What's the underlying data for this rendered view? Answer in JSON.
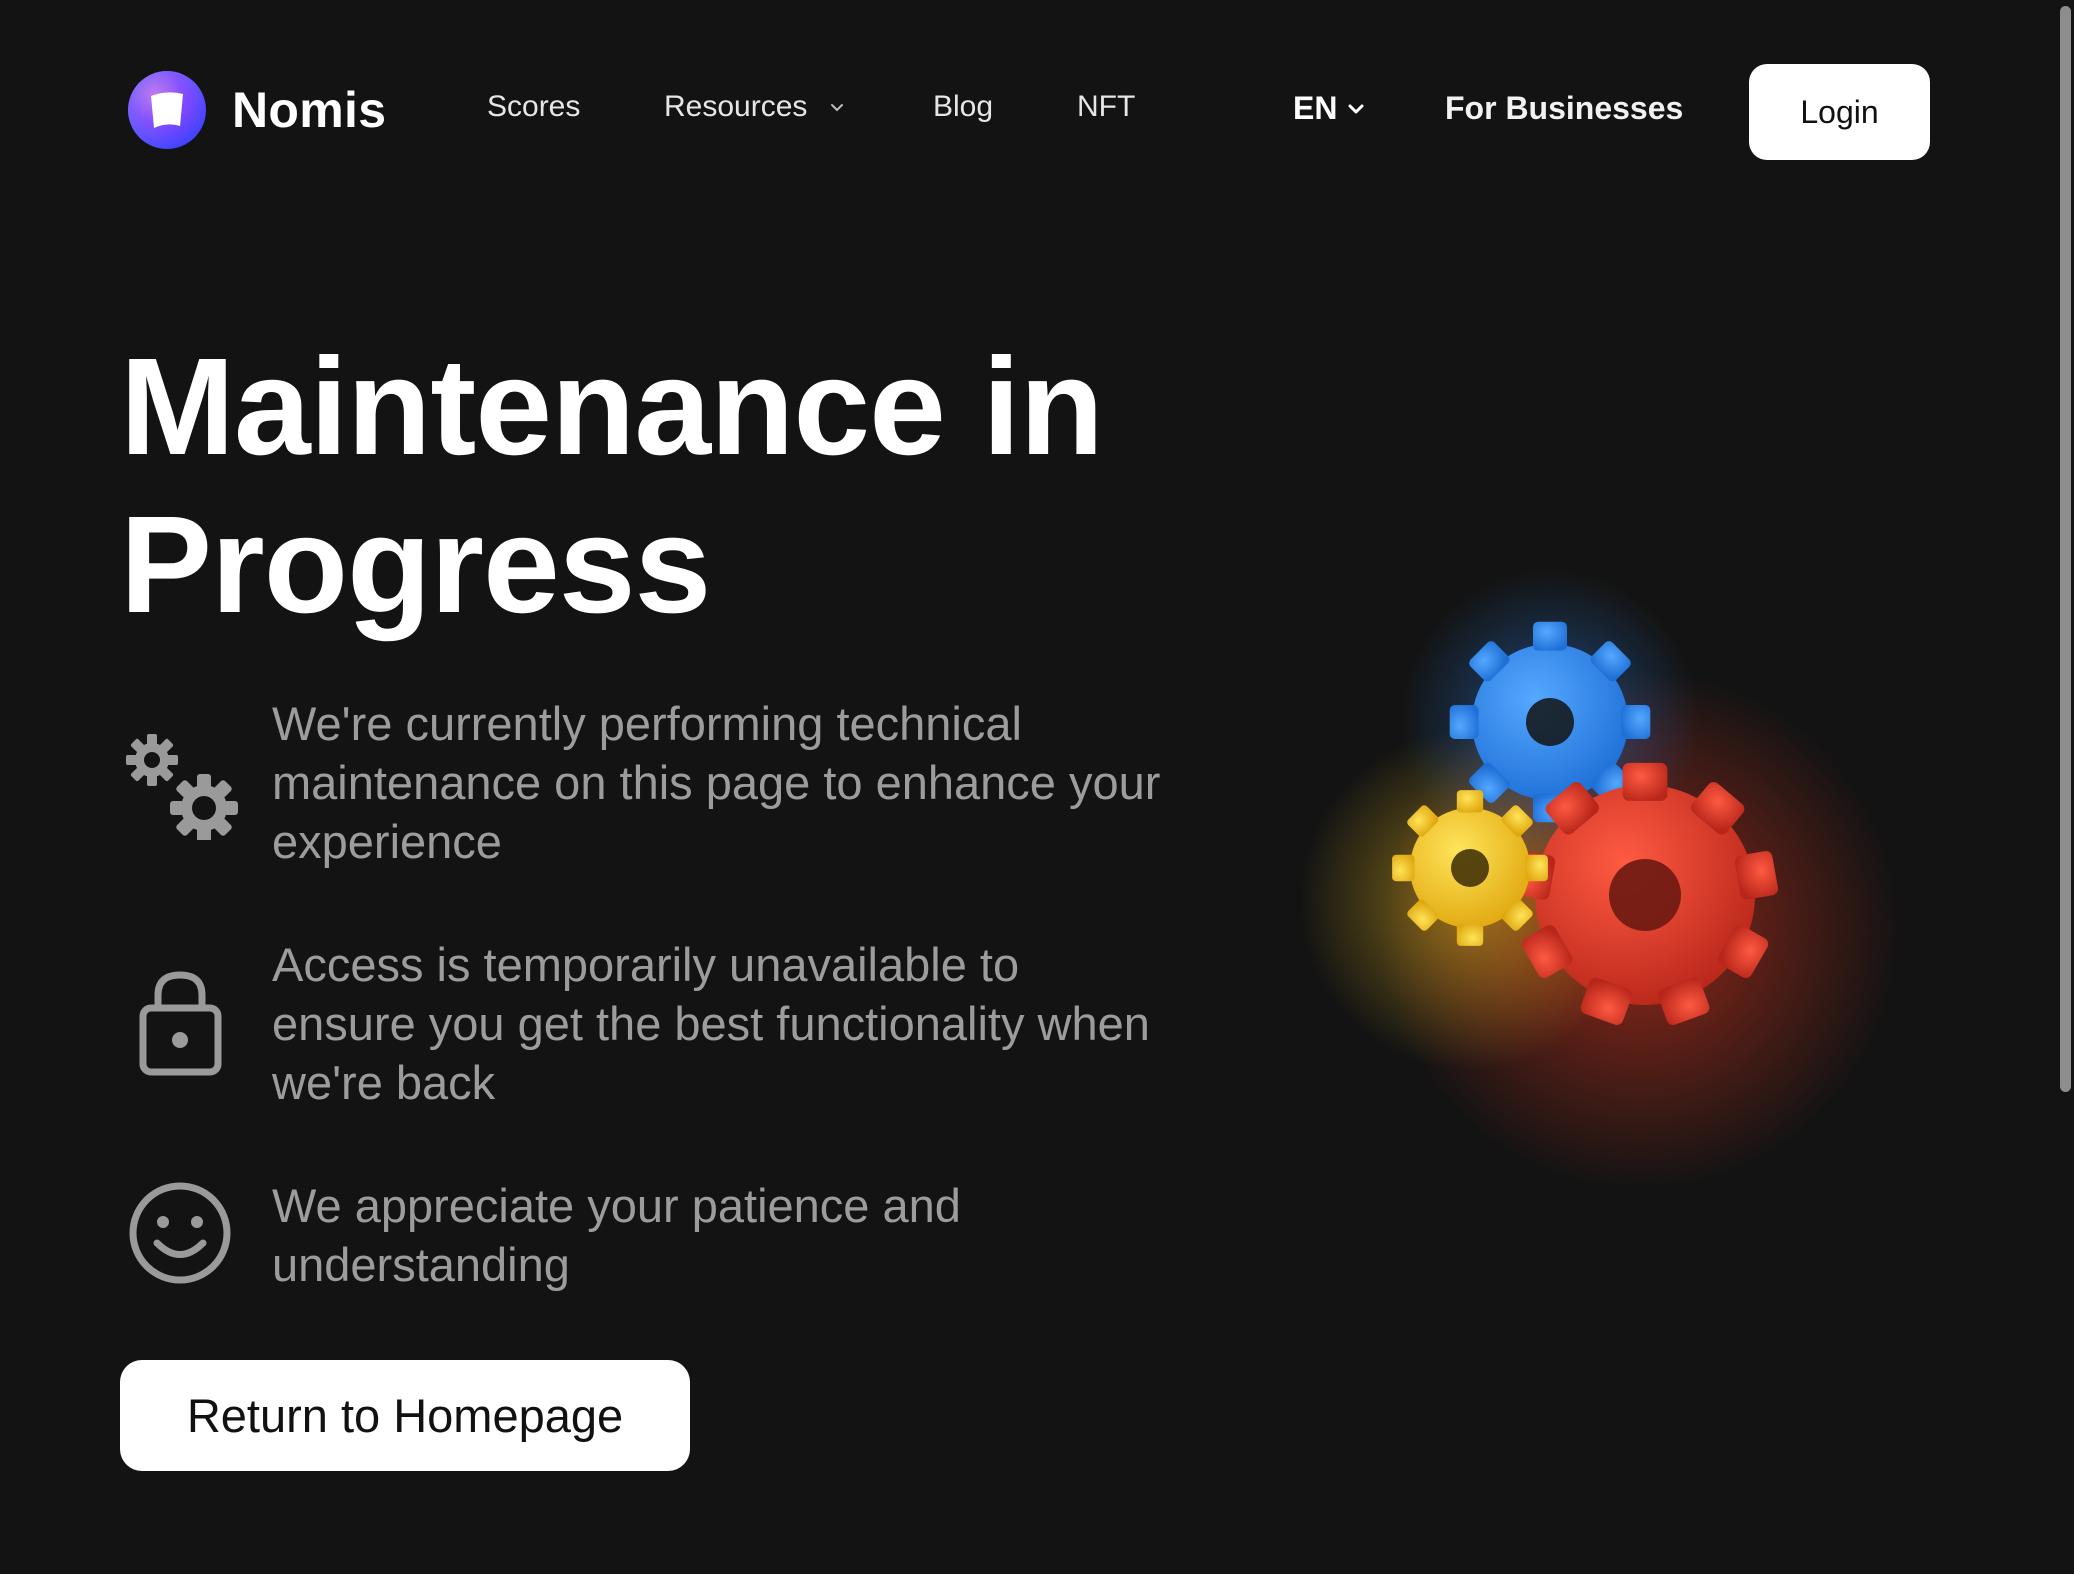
{
  "brand": {
    "name": "Nomis",
    "logo_icon": "nomis-logo-icon"
  },
  "nav": {
    "items": [
      {
        "label": "Scores"
      },
      {
        "label": "Resources",
        "icon": "chevron-down-icon"
      },
      {
        "label": "Blog"
      },
      {
        "label": "NFT"
      }
    ],
    "language": "EN",
    "for_businesses": "For Businesses",
    "login": "Login"
  },
  "hero": {
    "title": "Maintenance in Progress",
    "features": [
      {
        "icon": "gears-icon",
        "text": "We're currently performing technical maintenance on this page to enhance your experience"
      },
      {
        "icon": "lock-icon",
        "text": "Access is temporarily unavailable to ensure you get the best functionality when we're back"
      },
      {
        "icon": "smiley-icon",
        "text": "We appreciate your patience and understanding"
      }
    ],
    "cta": "Return to Homepage"
  },
  "illustration": {
    "icon": "gears-illustration",
    "colors": {
      "blue": "#2f8bef",
      "yellow": "#f3c928",
      "red": "#dd3a26"
    }
  },
  "colors": {
    "background": "#131313",
    "text_primary": "#ffffff",
    "text_secondary": "#9c9c9c",
    "button_bg": "#ffffff",
    "logo_gradient": [
      "#4f7cff",
      "#9b30ff",
      "#ff4fd8"
    ]
  }
}
